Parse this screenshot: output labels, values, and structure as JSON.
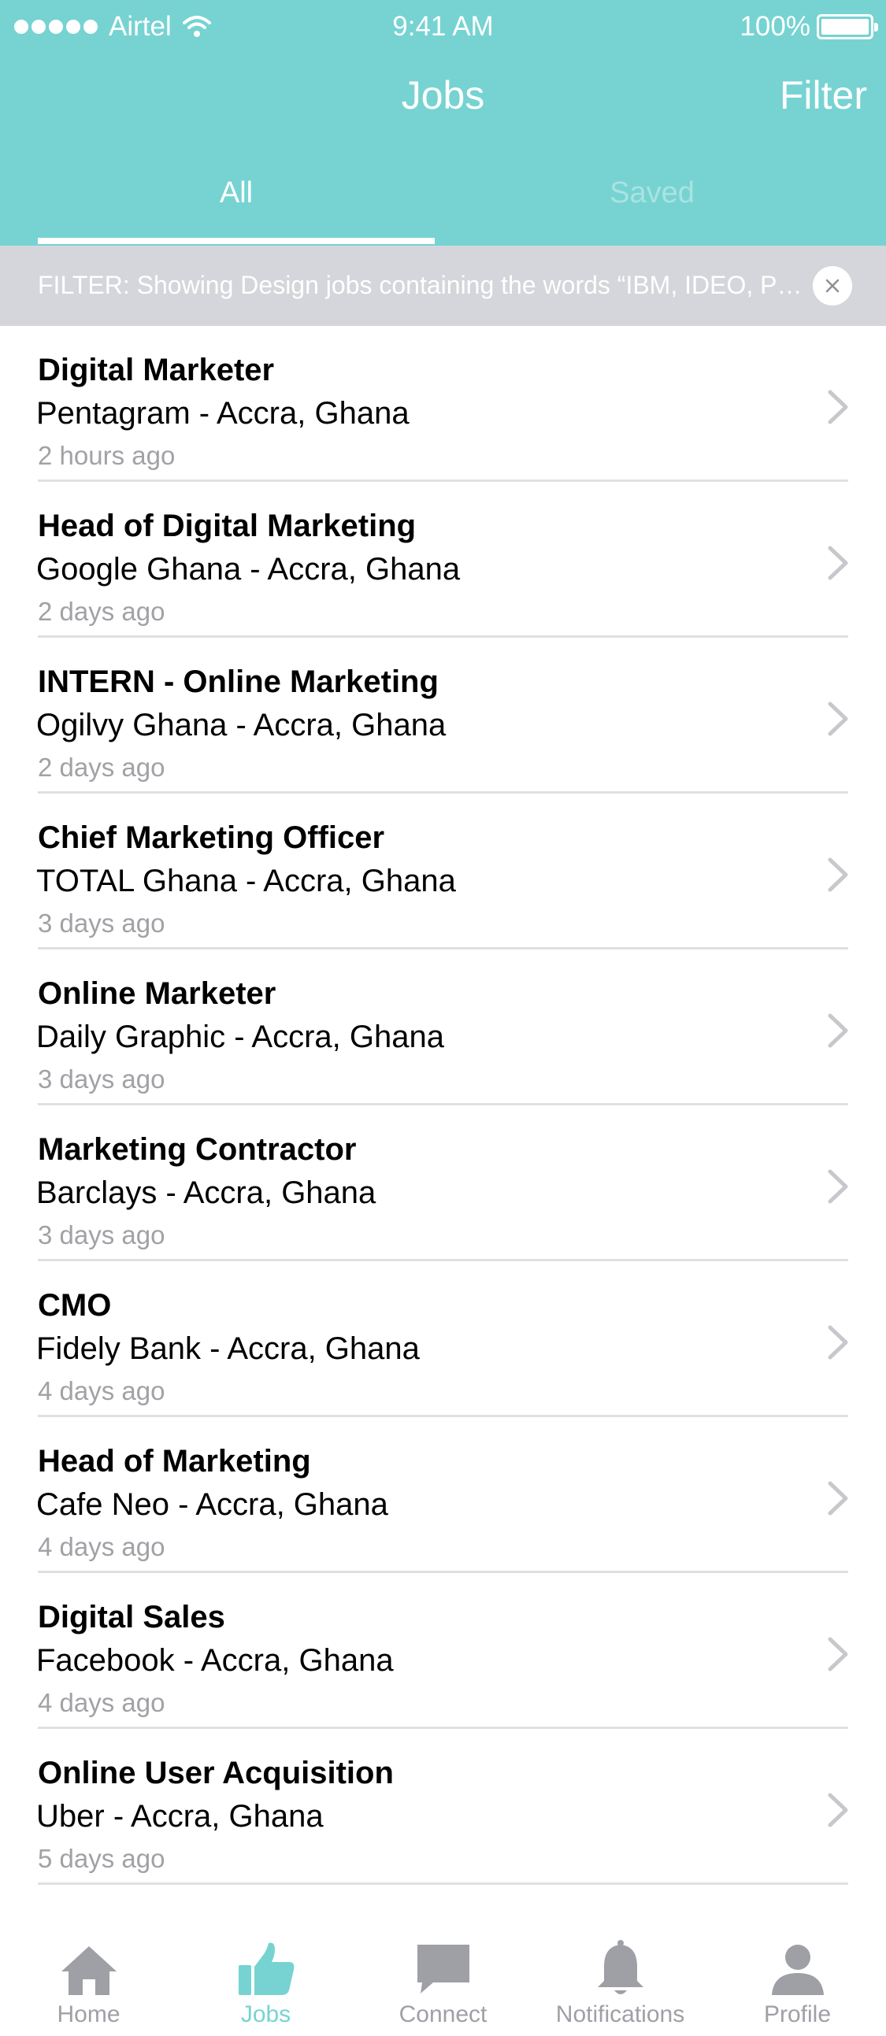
{
  "status_bar": {
    "carrier": "Airtel",
    "time": "9:41 AM",
    "battery": "100%"
  },
  "nav": {
    "title": "Jobs",
    "filter_label": "Filter"
  },
  "tabs": [
    {
      "label": "All",
      "active": true
    },
    {
      "label": "Saved",
      "active": false
    }
  ],
  "filter_banner": {
    "text": "FILTER: Showing Design jobs containing the words “IBM, IDEO, Pentagram”"
  },
  "jobs": [
    {
      "title": "Digital Marketer",
      "company": "Pentagram - Accra, Ghana",
      "posted": "2 hours ago"
    },
    {
      "title": "Head of Digital Marketing",
      "company": "Google Ghana - Accra, Ghana",
      "posted": "2 days ago"
    },
    {
      "title": "INTERN - Online Marketing",
      "company": "Ogilvy Ghana - Accra, Ghana",
      "posted": "2 days ago"
    },
    {
      "title": "Chief Marketing Officer",
      "company": "TOTAL Ghana - Accra, Ghana",
      "posted": "3 days ago"
    },
    {
      "title": "Online Marketer",
      "company": "Daily Graphic - Accra, Ghana",
      "posted": "3 days ago"
    },
    {
      "title": "Marketing Contractor",
      "company": "Barclays - Accra, Ghana",
      "posted": "3 days ago"
    },
    {
      "title": "CMO",
      "company": "Fidely Bank - Accra, Ghana",
      "posted": "4 days ago"
    },
    {
      "title": "Head of Marketing",
      "company": "Cafe Neo - Accra, Ghana",
      "posted": "4 days ago"
    },
    {
      "title": "Digital Sales",
      "company": "Facebook - Accra, Ghana",
      "posted": "4 days ago"
    },
    {
      "title": "Online User Acquisition",
      "company": "Uber - Accra, Ghana",
      "posted": "5 days ago"
    }
  ],
  "tabbar": [
    {
      "label": "Home",
      "icon": "home-icon",
      "active": false
    },
    {
      "label": "Jobs",
      "icon": "thumbs-up-icon",
      "active": true
    },
    {
      "label": "Connect",
      "icon": "chat-bubble-icon",
      "active": false
    },
    {
      "label": "Notifications",
      "icon": "bell-icon",
      "active": false
    },
    {
      "label": "Profile",
      "icon": "person-icon",
      "active": false
    }
  ],
  "colors": {
    "accent": "#76d3d2",
    "inactive_icon": "#9ea0a6",
    "filter_bar": "#d5d6db"
  }
}
